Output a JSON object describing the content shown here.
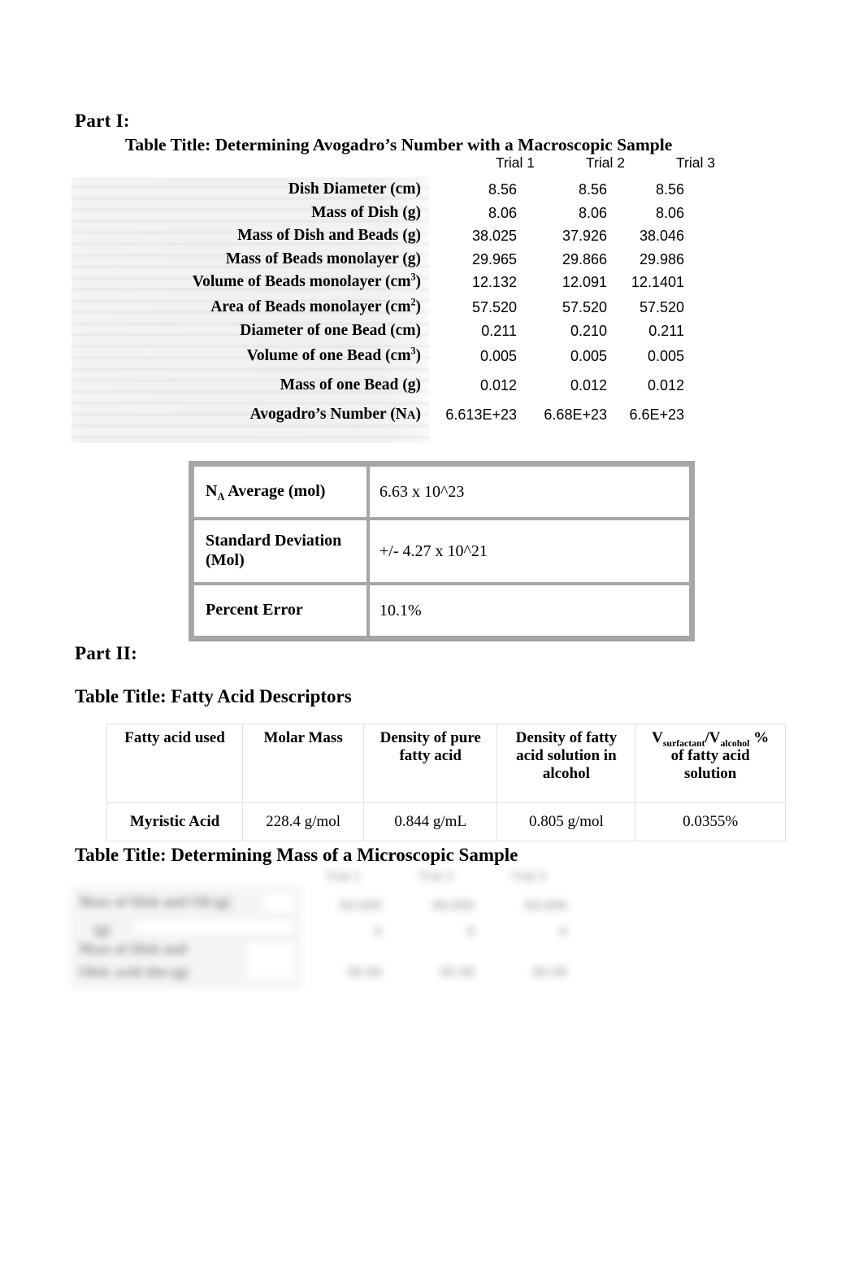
{
  "document": {
    "part1_heading": "Part I:",
    "part2_heading": "Part II:"
  },
  "table1": {
    "title": "Table Title: Determining Avogadro’s Number with a Macroscopic Sample",
    "columns": [
      "Trial 1",
      "Trial 2",
      "Trial 3"
    ],
    "rows": [
      {
        "label": "Dish Diameter (cm)",
        "values": [
          "8.56",
          "8.56",
          "8.56"
        ]
      },
      {
        "label": "Mass of Dish (g)",
        "values": [
          "8.06",
          "8.06",
          "8.06"
        ]
      },
      {
        "label": "Mass of Dish and Beads (g)",
        "values": [
          "38.025",
          "37.926",
          "38.046"
        ]
      },
      {
        "label": "Mass of Beads monolayer (g)",
        "values": [
          "29.965",
          "29.866",
          "29.986"
        ]
      },
      {
        "label": "Volume of Beads monolayer (cm3)",
        "label_base": "Volume of Beads monolayer (cm",
        "label_sup": "3",
        "label_tail": ")",
        "values": [
          "12.132",
          "12.091",
          "12.1401"
        ]
      },
      {
        "label": "Area of Beads monolayer (cm2)",
        "label_base": "Area of Beads monolayer (cm",
        "label_sup": "2",
        "label_tail": ")",
        "values": [
          "57.520",
          "57.520",
          "57.520"
        ]
      },
      {
        "label": "Diameter of one Bead (cm)",
        "values": [
          "0.211",
          "0.210",
          "0.211"
        ]
      },
      {
        "label": "Volume of one Bead (cm3)",
        "label_base": "Volume of one Bead (cm",
        "label_sup": "3",
        "label_tail": ")",
        "values": [
          "0.005",
          "0.005",
          "0.005"
        ]
      },
      {
        "label": "Mass of one Bead (g)",
        "values": [
          "0.012",
          "0.012",
          "0.012"
        ]
      },
      {
        "label": "Avogadro’s Number (NA)",
        "label_base": "Avogadro’s Number (N",
        "label_sub": "A",
        "label_tail": ")",
        "values": [
          "6.613E+23",
          "6.68E+23",
          "6.6E+23"
        ]
      }
    ]
  },
  "table2": {
    "rows": [
      {
        "key_base": "N",
        "key_sub": "A",
        "key_tail": " Average (mol)",
        "value": "6.63 x 10^23"
      },
      {
        "key_base": "Standard Deviation (Mol)",
        "value": "+/- 4.27 x 10^21"
      },
      {
        "key_base": "Percent Error",
        "value": "10.1%"
      }
    ]
  },
  "table3": {
    "title": "Table Title: Fatty Acid Descriptors",
    "headers": [
      {
        "text": "Fatty acid used"
      },
      {
        "text": "Molar Mass"
      },
      {
        "text": "Density of pure fatty acid"
      },
      {
        "text": "Density of fatty acid solution in alcohol"
      },
      {
        "text": "Vsurfactant/Valcohol % of fatty acid solution",
        "v1": "V",
        "v1sub": "surfactant",
        "slash": "/",
        "v2": "V",
        "v2sub": "alcohol",
        "pct": " %",
        "line2": "of fatty acid",
        "line3": "solution"
      }
    ],
    "row": [
      "Myristic Acid",
      "228.4 g/mol",
      "0.844 g/mL",
      "0.805 g/mol",
      "0.0355%"
    ]
  },
  "table4": {
    "title": "Table Title: Determining Mass of a Microscopic Sample",
    "note": "content blurred / illegible in source",
    "columns": [
      "",
      "",
      ""
    ],
    "rows": [
      {
        "label": "",
        "values": [
          "",
          "",
          ""
        ]
      },
      {
        "label": "",
        "values": [
          "",
          "",
          ""
        ]
      },
      {
        "label": "",
        "values": [
          "",
          "",
          ""
        ]
      }
    ]
  },
  "colors": {
    "text": "#000000",
    "table2_border": "#a6a6a6",
    "table1_panel": "#ededed",
    "table3_border": "#e2e2e2"
  }
}
